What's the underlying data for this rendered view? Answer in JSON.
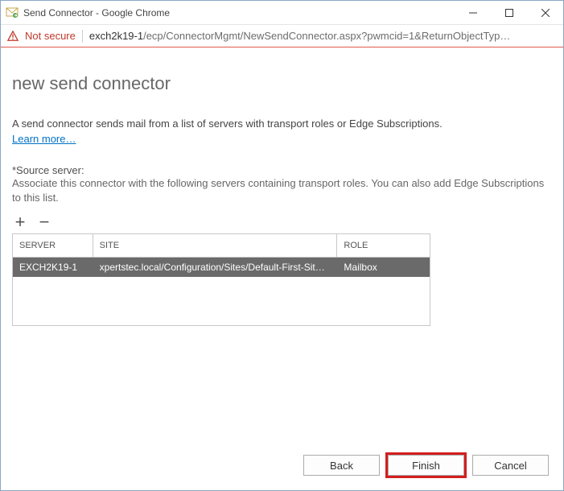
{
  "window": {
    "title": "Send Connector - Google Chrome"
  },
  "addressbar": {
    "not_secure": "Not secure",
    "host": "exch2k19-1",
    "path": "/ecp/ConnectorMgmt/NewSendConnector.aspx?pwmcid=1&ReturnObjectTyp…"
  },
  "page": {
    "title": "new send connector",
    "description": "A send connector sends mail from a list of servers with transport roles or Edge Subscriptions.",
    "learn_more": "Learn more…",
    "source_label": "*Source server:",
    "source_desc": "Associate this connector with the following servers containing transport roles. You can also add Edge Subscriptions to this list."
  },
  "grid": {
    "headers": {
      "server": "SERVER",
      "site": "SITE",
      "role": "ROLE"
    },
    "rows": [
      {
        "server": "EXCH2K19-1",
        "site": "xpertstec.local/Configuration/Sites/Default-First-Sit…",
        "role": "Mailbox"
      }
    ]
  },
  "buttons": {
    "back": "Back",
    "finish": "Finish",
    "cancel": "Cancel"
  }
}
